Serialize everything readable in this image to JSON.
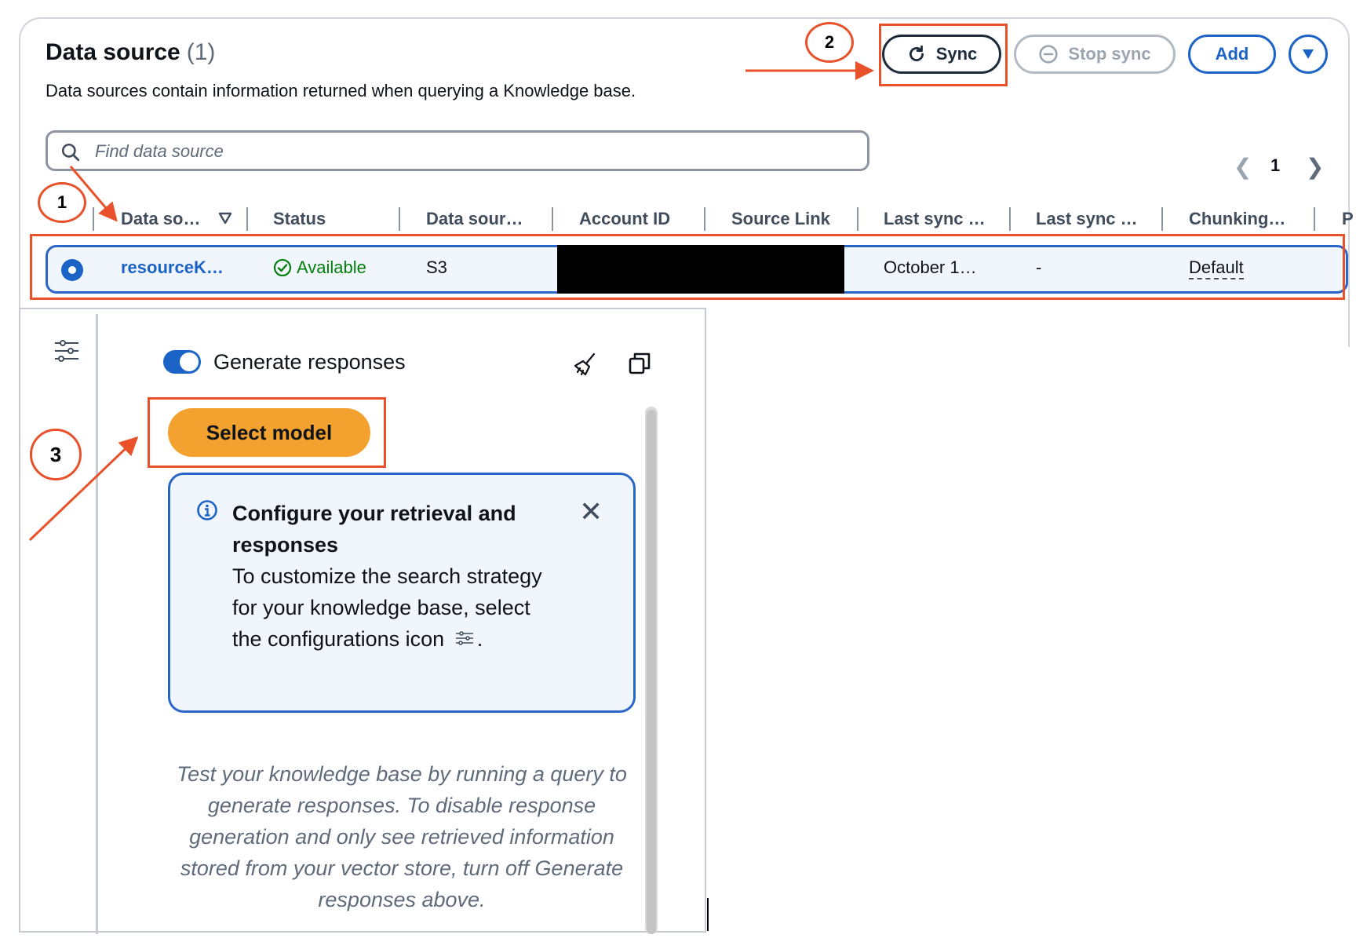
{
  "panel": {
    "title": "Data source",
    "count": "(1)",
    "description": "Data sources contain information returned when querying a Knowledge base."
  },
  "toolbar": {
    "sync_label": "Sync",
    "stop_sync_label": "Stop sync",
    "add_label": "Add"
  },
  "search": {
    "placeholder": "Find data source"
  },
  "pagination": {
    "current": "1"
  },
  "table": {
    "columns": [
      "Data so…",
      "Status",
      "Data sour…",
      "Account ID",
      "Source Link",
      "Last sync …",
      "Last sync …",
      "Chunking…",
      "P"
    ],
    "row": {
      "name": "resourceK…",
      "status": "Available",
      "type": "S3",
      "last_sync": "October 1…",
      "last_sync_2": "-",
      "chunking": "Default"
    }
  },
  "test_panel": {
    "toggle_label": "Generate responses",
    "select_model_label": "Select model",
    "info_title": "Configure your retrieval and responses",
    "info_text": "To customize the search strategy for your knowledge base, select the configurations icon",
    "info_text_end": ".",
    "hint": "Test your knowledge base by running a query to generate responses. To disable response generation and only see retrieved information stored from your vector store, turn off Generate responses above."
  },
  "annotations": {
    "step1": "1",
    "step2": "2",
    "step3": "3"
  },
  "colors": {
    "accent": "#1b63c6",
    "highlight": "#e8512a",
    "primary_button": "#f3a12f",
    "success": "#037f0c"
  }
}
